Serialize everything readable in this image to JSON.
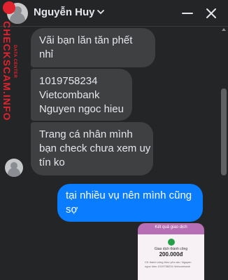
{
  "header": {
    "contact_name": "Nguyễn Huy",
    "minimize_icon": "minus-icon",
    "close_icon": "close-icon",
    "chevron_icon": "chevron-down-icon"
  },
  "watermark": {
    "main": "CHECKSCAM.INFO",
    "sub": "DATA CENTER"
  },
  "messages": {
    "incoming": [
      {
        "lines": [
          "Vãi bạn lăn tăn phết",
          "nhỉ"
        ]
      },
      {
        "lines": [
          "1019758234",
          "Vietcombank",
          "Nguyen ngoc hieu"
        ]
      },
      {
        "lines": [
          "Trang cá nhân mình",
          "bạn check chưa xem uy",
          "tín ko"
        ]
      }
    ],
    "outgoing": [
      {
        "lines": [
          "tại nhiều vụ nên mình cũng",
          "sợ"
        ]
      }
    ]
  },
  "attachment": {
    "title": "Kết quả giao dịch",
    "status": "Giao dịch thành công",
    "amount": "200.000đ",
    "detail": "CK thành công theo yêu cầu: Nguyen ngoc hieu 1019758234 Vietcombank"
  },
  "colors": {
    "background": "#242526",
    "incoming_bubble": "#3e4042",
    "outgoing_bubble": "#0a7cff",
    "watermark": "#e0232e"
  }
}
